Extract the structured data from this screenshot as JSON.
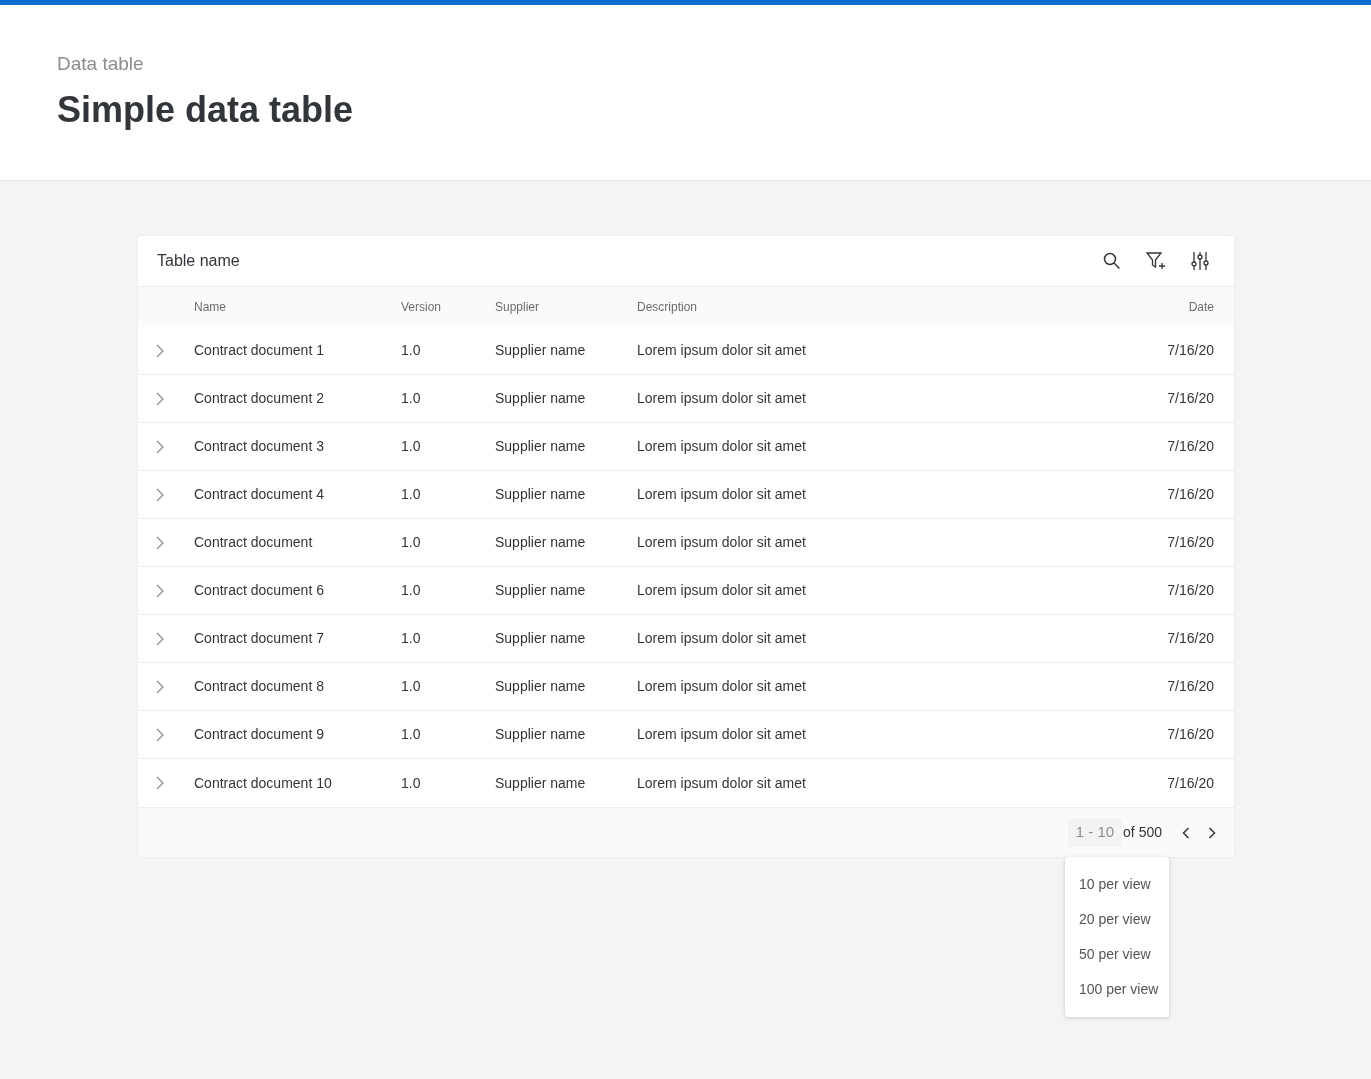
{
  "header": {
    "breadcrumb": "Data table",
    "title": "Simple data table"
  },
  "table": {
    "name": "Table name",
    "columns": [
      "Name",
      "Version",
      "Supplier",
      "Description",
      "Date"
    ],
    "rows": [
      {
        "expanded": false,
        "cells": [
          "Contract document 1",
          "1.0",
          "Supplier name",
          "Lorem ipsum dolor sit amet",
          "7/16/20"
        ]
      },
      {
        "expanded": false,
        "cells": [
          "Contract document 2",
          "1.0",
          "Supplier name",
          "Lorem ipsum dolor sit amet",
          "7/16/20"
        ]
      },
      {
        "expanded": false,
        "cells": [
          "Contract document 3",
          "1.0",
          "Supplier name",
          "Lorem ipsum dolor sit amet",
          "7/16/20"
        ]
      },
      {
        "expanded": false,
        "cells": [
          "Contract document 4",
          "1.0",
          "Supplier name",
          "Lorem ipsum dolor sit amet",
          "7/16/20"
        ]
      },
      {
        "expanded": false,
        "cells": [
          "Contract document",
          "1.0",
          "Supplier name",
          "Lorem ipsum dolor sit amet",
          "7/16/20"
        ]
      },
      {
        "expanded": false,
        "cells": [
          "Contract document 6",
          "1.0",
          "Supplier name",
          "Lorem ipsum dolor sit amet",
          "7/16/20"
        ]
      },
      {
        "expanded": false,
        "cells": [
          "Contract document 7",
          "1.0",
          "Supplier name",
          "Lorem ipsum dolor sit amet",
          "7/16/20"
        ]
      },
      {
        "expanded": false,
        "cells": [
          "Contract document 8",
          "1.0",
          "Supplier name",
          "Lorem ipsum dolor sit amet",
          "7/16/20"
        ]
      },
      {
        "expanded": false,
        "cells": [
          "Contract document 9",
          "1.0",
          "Supplier name",
          "Lorem ipsum dolor sit amet",
          "7/16/20"
        ]
      },
      {
        "expanded": false,
        "cells": [
          "Contract document 10",
          "1.0",
          "Supplier name",
          "Lorem ipsum dolor sit amet",
          "7/16/20"
        ]
      }
    ],
    "pagination": {
      "range": "1 - 10",
      "total": "of 500",
      "menu_expanded": true,
      "menu": [
        "10 per view",
        "20 per view",
        "50 per view",
        "100 per view"
      ]
    }
  }
}
